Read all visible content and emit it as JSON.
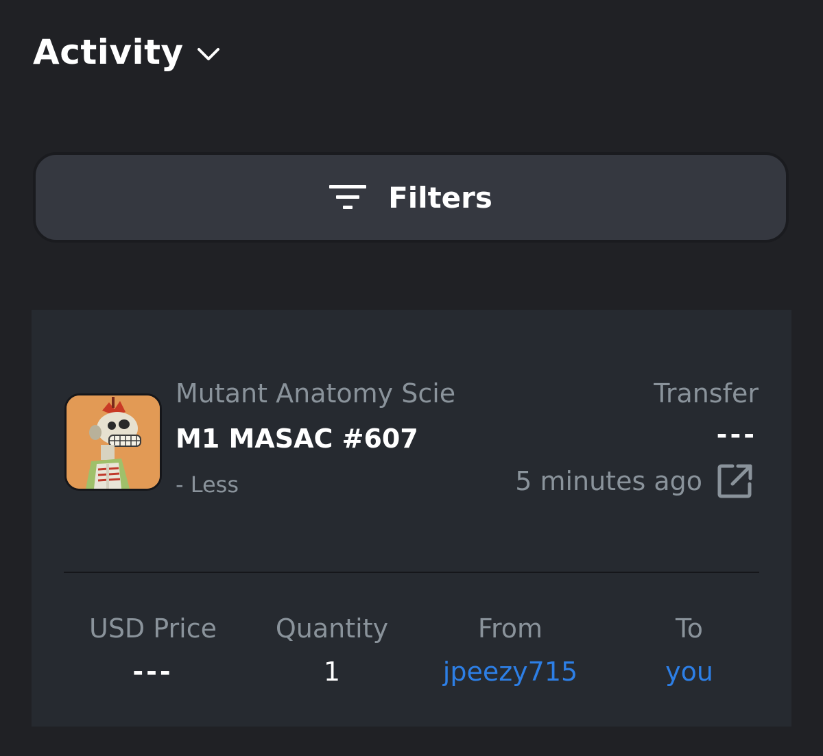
{
  "header": {
    "title": "Activity",
    "dropdown_icon": "chevron-down-icon"
  },
  "filters": {
    "label": "Filters",
    "icon": "filter-lines-icon"
  },
  "activity_item": {
    "collection": "Mutant Anatomy Scie",
    "name": "M1 MASAC #607",
    "less_label": "- Less",
    "event": "Transfer",
    "price": "---",
    "time": "5 minutes ago",
    "link_icon": "external-link-icon",
    "thumbnail": "nft-thumbnail"
  },
  "details": [
    {
      "label": "USD Price",
      "value": "---"
    },
    {
      "label": "Quantity",
      "value": "1"
    },
    {
      "label": "From",
      "value": "jpeezy715"
    },
    {
      "label": "To",
      "value": "you"
    }
  ],
  "colors": {
    "background": "#202125",
    "card": "#262a30",
    "button": "#353840",
    "muted_text": "#8a939b",
    "link": "#2d7fe6",
    "thumbnail_bg": "#e29a55"
  }
}
